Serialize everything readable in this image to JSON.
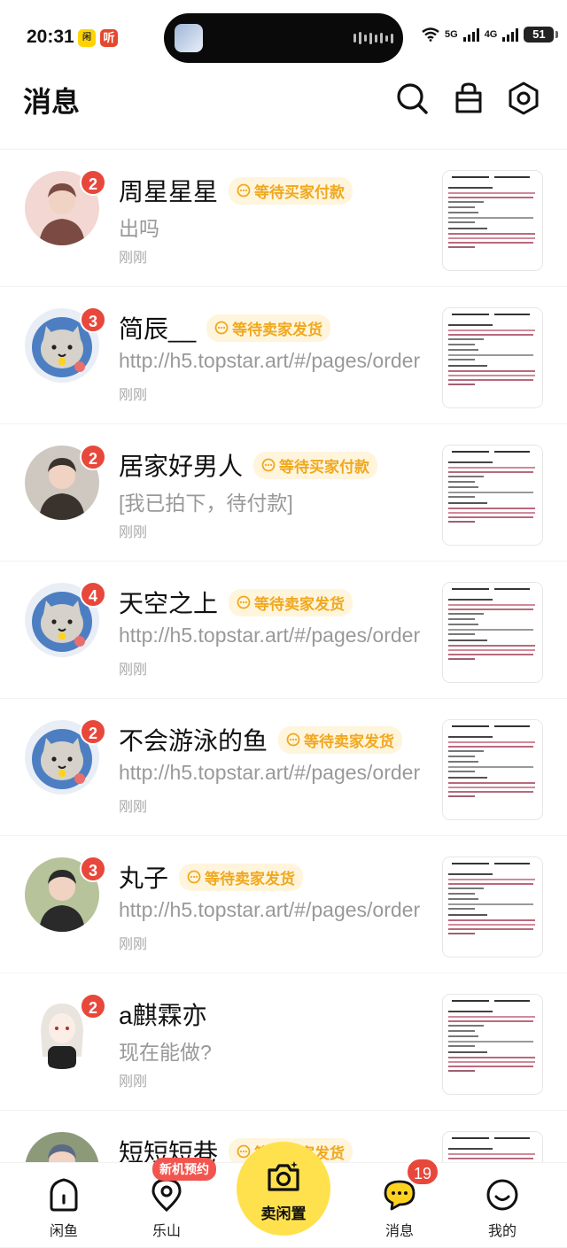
{
  "status_bar": {
    "time": "20:31",
    "app_icon_1": "闲",
    "app_icon_2": "听",
    "signal_1": "5G",
    "signal_2": "4G",
    "battery": "51"
  },
  "header": {
    "title": "消息",
    "icons": [
      "search-icon",
      "shopping-bag-icon",
      "settings-icon"
    ]
  },
  "conversations": [
    {
      "name": "周星星星",
      "tag": "等待买家付款",
      "message": "出吗",
      "time": "刚刚",
      "unread": "2",
      "avatar": "photo"
    },
    {
      "name": "简辰__",
      "tag": "等待卖家发货",
      "message": "http://h5.topstar.art/#/pages/order",
      "time": "刚刚",
      "unread": "3",
      "avatar": "default-cat"
    },
    {
      "name": "居家好男人",
      "tag": "等待买家付款",
      "message": "[我已拍下，待付款]",
      "time": "刚刚",
      "unread": "2",
      "avatar": "photo"
    },
    {
      "name": "天空之上",
      "tag": "等待卖家发货",
      "message": "http://h5.topstar.art/#/pages/order",
      "time": "刚刚",
      "unread": "4",
      "avatar": "default-cat"
    },
    {
      "name": "不会游泳的鱼",
      "tag": "等待卖家发货",
      "message": "http://h5.topstar.art/#/pages/order",
      "time": "刚刚",
      "unread": "2",
      "avatar": "default-cat"
    },
    {
      "name": "丸子",
      "tag": "等待卖家发货",
      "message": "http://h5.topstar.art/#/pages/order",
      "time": "刚刚",
      "unread": "3",
      "avatar": "photo"
    },
    {
      "name": "a麒霖亦",
      "tag": "",
      "message": "现在能做?",
      "time": "刚刚",
      "unread": "2",
      "avatar": "anime"
    },
    {
      "name": "短短短巷",
      "tag": "等待卖家发货",
      "message": "",
      "time": "",
      "unread": "",
      "avatar": "photo"
    }
  ],
  "tabbar": {
    "home": "闲鱼",
    "leshan": "乐山",
    "leshan_pill": "新机预约",
    "sell": "卖闲置",
    "messages": "消息",
    "messages_badge": "19",
    "mine": "我的"
  },
  "colors": {
    "accent_yellow": "#ffe14d",
    "badge_red": "#e8473b",
    "tag_orange": "#f0a81e",
    "tag_bg": "#fff5dd"
  }
}
